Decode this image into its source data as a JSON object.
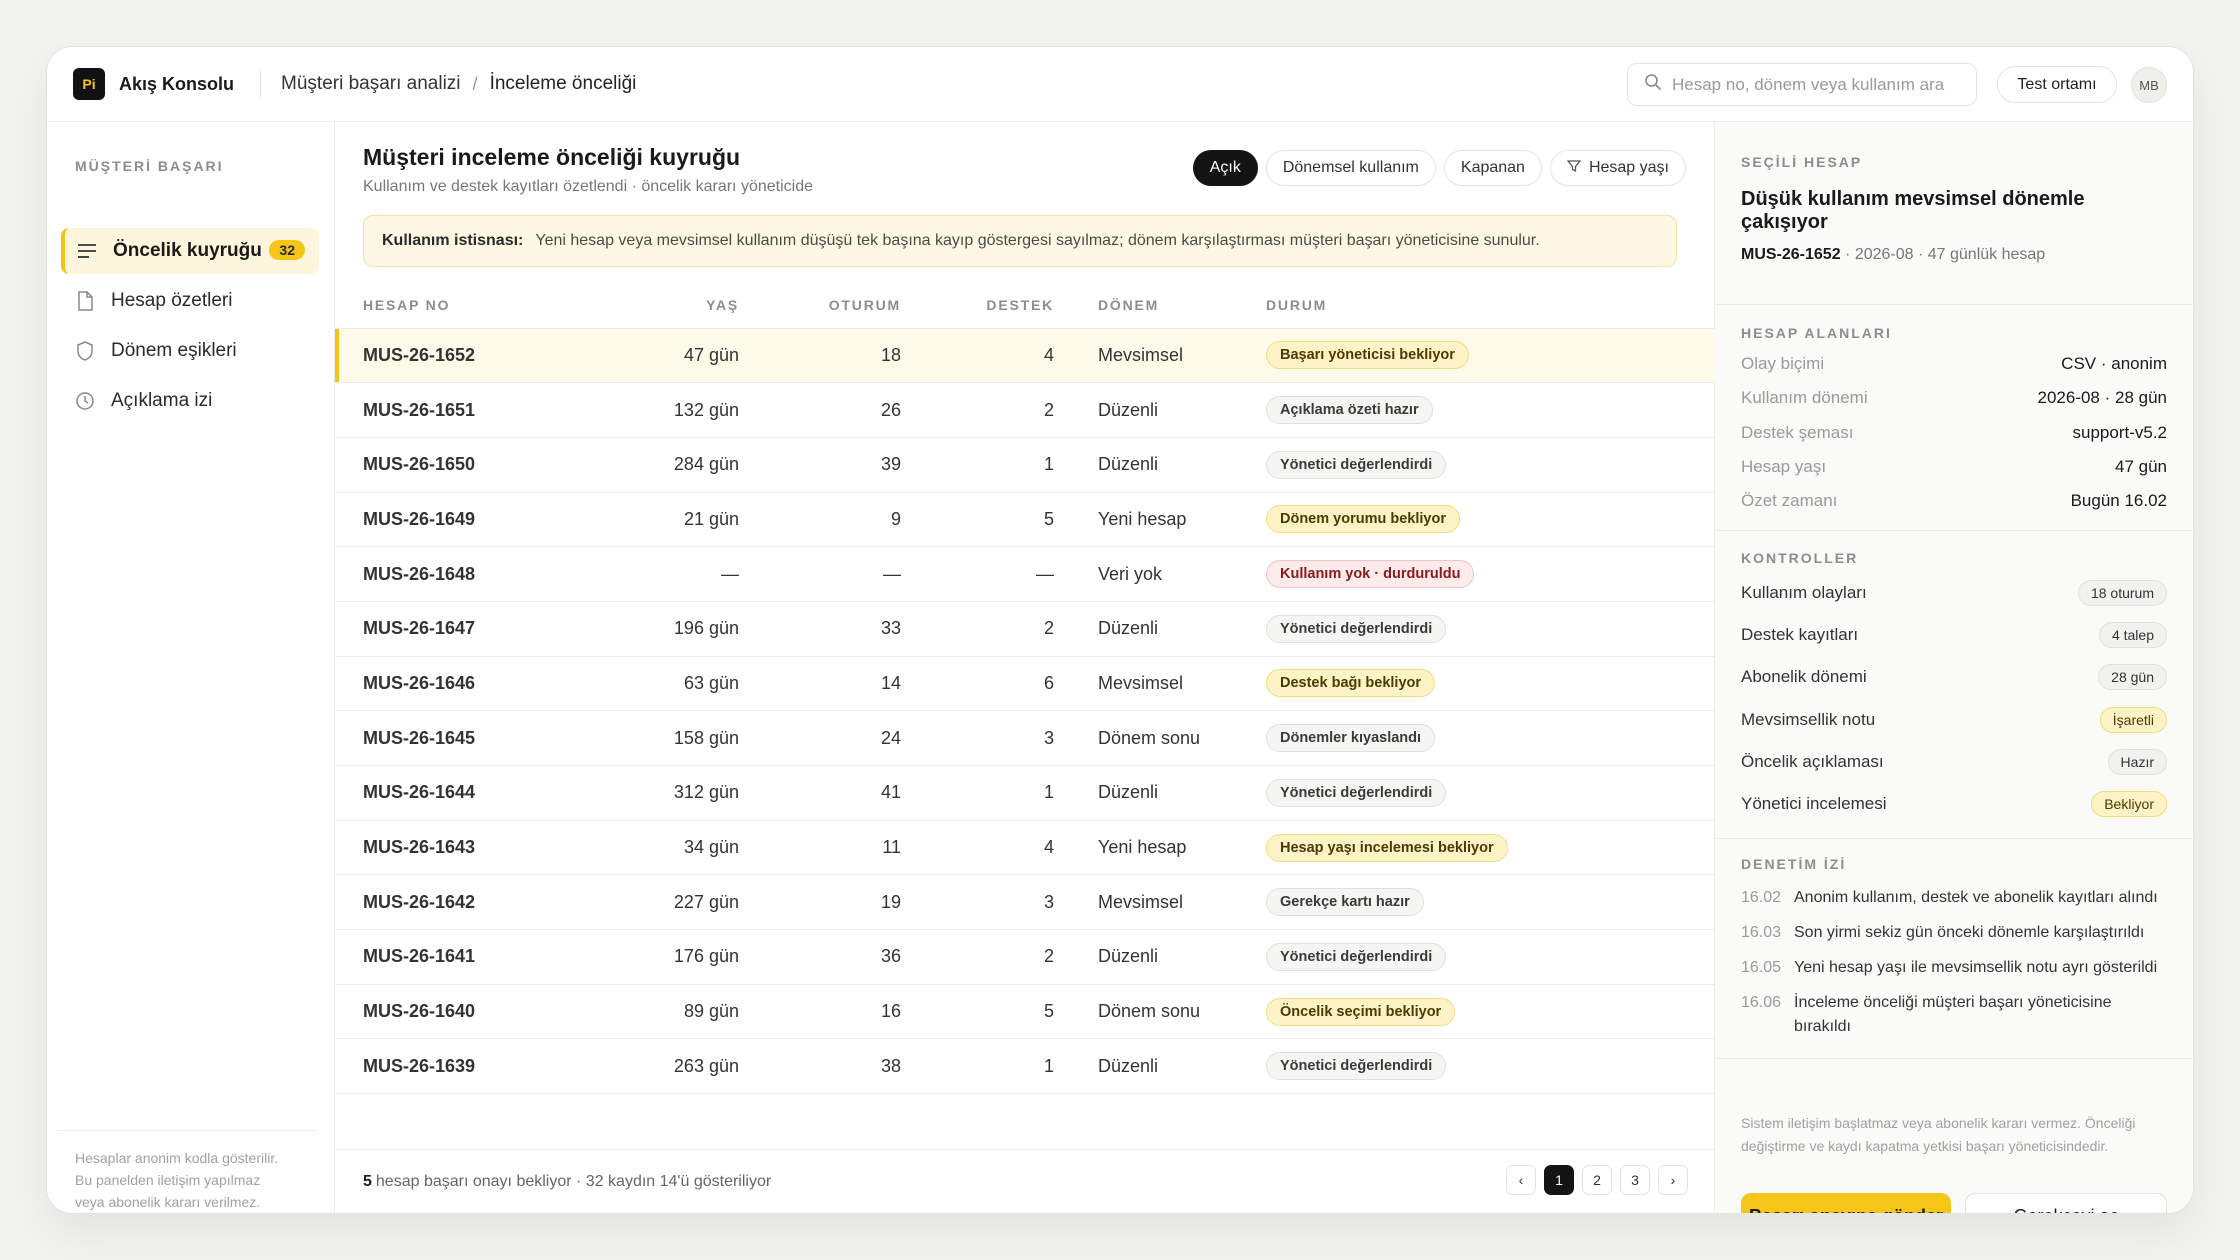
{
  "app": {
    "logo_text": "Pi",
    "name": "Akış Konsolu"
  },
  "breadcrumb": {
    "parent": "Müşteri başarı analizi",
    "separator": "/",
    "current": "İnceleme önceliği"
  },
  "search": {
    "placeholder": "Hesap no, dönem veya kullanım ara"
  },
  "header": {
    "env_label": "Test ortamı",
    "avatar_initials": "MB"
  },
  "sidebar": {
    "section": "MÜŞTERİ BAŞARI",
    "items": [
      {
        "label": "Öncelik kuyruğu",
        "icon": "list-icon",
        "badge": "32",
        "active": true
      },
      {
        "label": "Hesap özetleri",
        "icon": "document-icon"
      },
      {
        "label": "Dönem eşikleri",
        "icon": "shield-icon"
      },
      {
        "label": "Açıklama izi",
        "icon": "clock-icon"
      }
    ],
    "footer_lines": [
      "Hesaplar anonim kodla gösterilir.",
      "Bu panelden iletişim yapılmaz",
      "veya abonelik kararı verilmez."
    ]
  },
  "main": {
    "title": "Müşteri inceleme önceliği kuyruğu",
    "subtitle": "Kullanım ve destek kayıtları özetlendi · öncelik kararı yöneticide",
    "filters": [
      {
        "label": "Açık",
        "active": true
      },
      {
        "label": "Dönemsel kullanım"
      },
      {
        "label": "Kapanan"
      },
      {
        "label": "Hesap yaşı",
        "icon": "filter-icon"
      }
    ],
    "notice": {
      "label": "Kullanım istisnası:",
      "text": "Yeni hesap veya mevsimsel kullanım düşüşü tek başına kayıp göstergesi sayılmaz; dönem karşılaştırması müşteri başarı yöneticisine sunulur."
    },
    "columns": [
      "HESAP NO",
      "YAŞ",
      "OTURUM",
      "DESTEK",
      "DÖNEM",
      "DURUM"
    ],
    "rows": [
      {
        "id": "MUS-26-1652",
        "age": "47 gün",
        "sessions": "18",
        "support": "4",
        "period": "Mevsimsel",
        "status": "Başarı yöneticisi bekliyor",
        "tone": "warn"
      },
      {
        "id": "MUS-26-1651",
        "age": "132 gün",
        "sessions": "26",
        "support": "2",
        "period": "Düzenli",
        "status": "Açıklama özeti hazır",
        "tone": "neutral"
      },
      {
        "id": "MUS-26-1650",
        "age": "284 gün",
        "sessions": "39",
        "support": "1",
        "period": "Düzenli",
        "status": "Yönetici değerlendirdi",
        "tone": "neutral"
      },
      {
        "id": "MUS-26-1649",
        "age": "21 gün",
        "sessions": "9",
        "support": "5",
        "period": "Yeni hesap",
        "status": "Dönem yorumu bekliyor",
        "tone": "warn"
      },
      {
        "id": "MUS-26-1648",
        "age": "—",
        "sessions": "—",
        "support": "—",
        "period": "Veri yok",
        "status": "Kullanım yok · durduruldu",
        "tone": "danger"
      },
      {
        "id": "MUS-26-1647",
        "age": "196 gün",
        "sessions": "33",
        "support": "2",
        "period": "Düzenli",
        "status": "Yönetici değerlendirdi",
        "tone": "neutral"
      },
      {
        "id": "MUS-26-1646",
        "age": "63 gün",
        "sessions": "14",
        "support": "6",
        "period": "Mevsimsel",
        "status": "Destek bağı bekliyor",
        "tone": "warn"
      },
      {
        "id": "MUS-26-1645",
        "age": "158 gün",
        "sessions": "24",
        "support": "3",
        "period": "Dönem sonu",
        "status": "Dönemler kıyaslandı",
        "tone": "neutral"
      },
      {
        "id": "MUS-26-1644",
        "age": "312 gün",
        "sessions": "41",
        "support": "1",
        "period": "Düzenli",
        "status": "Yönetici değerlendirdi",
        "tone": "neutral"
      },
      {
        "id": "MUS-26-1643",
        "age": "34 gün",
        "sessions": "11",
        "support": "4",
        "period": "Yeni hesap",
        "status": "Hesap yaşı incelemesi bekliyor",
        "tone": "warn"
      },
      {
        "id": "MUS-26-1642",
        "age": "227 gün",
        "sessions": "19",
        "support": "3",
        "period": "Mevsimsel",
        "status": "Gerekçe kartı hazır",
        "tone": "neutral"
      },
      {
        "id": "MUS-26-1641",
        "age": "176 gün",
        "sessions": "36",
        "support": "2",
        "period": "Düzenli",
        "status": "Yönetici değerlendirdi",
        "tone": "neutral"
      },
      {
        "id": "MUS-26-1640",
        "age": "89 gün",
        "sessions": "16",
        "support": "5",
        "period": "Dönem sonu",
        "status": "Öncelik seçimi bekliyor",
        "tone": "warn"
      },
      {
        "id": "MUS-26-1639",
        "age": "263 gün",
        "sessions": "38",
        "support": "1",
        "period": "Düzenli",
        "status": "Yönetici değerlendirdi",
        "tone": "neutral"
      }
    ],
    "footer": {
      "count": "5",
      "text": "hesap başarı onayı bekliyor · 32 kaydın 14'ü gösteriliyor"
    },
    "pager": {
      "prev": "‹",
      "pages": [
        "1",
        "2",
        "3"
      ],
      "next": "›",
      "current": "1"
    }
  },
  "panel": {
    "section": "SEÇİLİ HESAP",
    "title": "Düşük kullanım mevsimsel dönemle çakışıyor",
    "account_id": "MUS-26-1652",
    "account_meta": " · 2026-08 · 47 günlük hesap",
    "fields_label": "HESAP ALANLARI",
    "fields": [
      {
        "key": "Olay biçimi",
        "value": "CSV · anonim"
      },
      {
        "key": "Kullanım dönemi",
        "value": "2026-08 · 28 gün"
      },
      {
        "key": "Destek şeması",
        "value": "support-v5.2"
      },
      {
        "key": "Hesap yaşı",
        "value": "47 gün"
      },
      {
        "key": "Özet zamanı",
        "value": "Bugün 16.02"
      }
    ],
    "controls_label": "KONTROLLER",
    "controls": [
      {
        "label": "Kullanım olayları",
        "value": "18 oturum",
        "tone": "neutral"
      },
      {
        "label": "Destek kayıtları",
        "value": "4 talep",
        "tone": "neutral"
      },
      {
        "label": "Abonelik dönemi",
        "value": "28 gün",
        "tone": "neutral"
      },
      {
        "label": "Mevsimsellik notu",
        "value": "İşaretli",
        "tone": "warn"
      },
      {
        "label": "Öncelik açıklaması",
        "value": "Hazır",
        "tone": "neutral"
      },
      {
        "label": "Yönetici incelemesi",
        "value": "Bekliyor",
        "tone": "warn"
      }
    ],
    "audit_label": "DENETİM İZİ",
    "audit": [
      {
        "time": "16.02",
        "text": "Anonim kullanım, destek ve abonelik kayıtları alındı"
      },
      {
        "time": "16.03",
        "text": "Son yirmi sekiz gün önceki dönemle karşılaştırıldı"
      },
      {
        "time": "16.05",
        "text": "Yeni hesap yaşı ile mevsimsellik notu ayrı gösterildi"
      },
      {
        "time": "16.06",
        "text": "İnceleme önceliği müşteri başarı yöneticisine bırakıldı"
      }
    ],
    "note": "Sistem iletişim başlatmaz veya abonelik kararı vermez. Önceliği değiştirme ve kaydı kapatma yetkisi başarı yöneticisindedir.",
    "primary_action": "Başarı onayına gönder",
    "secondary_action": "Gerekçeyi aç"
  },
  "colors": {
    "accent": "#f5c518",
    "dark": "#141414",
    "warn_bg": "#fdf3c6",
    "danger_bg": "#fdeaea"
  }
}
